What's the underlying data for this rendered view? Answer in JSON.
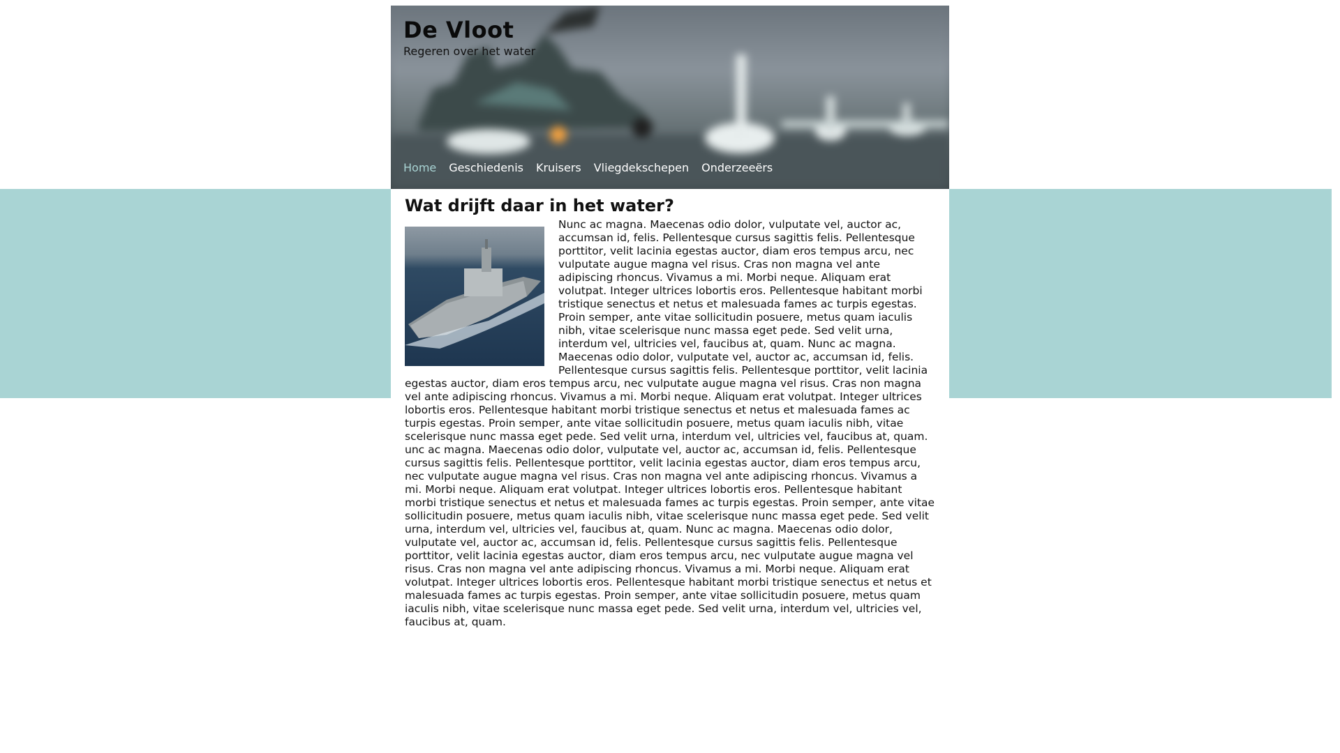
{
  "site": {
    "title": "De Vloot",
    "tagline": "Regeren over het water"
  },
  "nav": {
    "items": [
      {
        "label": "Home",
        "active": true
      },
      {
        "label": "Geschiedenis",
        "active": false
      },
      {
        "label": "Kruisers",
        "active": false
      },
      {
        "label": "Vliegdekschepen",
        "active": false
      },
      {
        "label": "Onderzeeërs",
        "active": false
      }
    ]
  },
  "article": {
    "heading": "Wat drijft daar in het water?",
    "body": "Nunc ac magna. Maecenas odio dolor, vulputate vel, auctor ac, accumsan id, felis. Pellentesque cursus sagittis felis. Pellentesque porttitor, velit lacinia egestas auctor, diam eros tempus arcu, nec vulputate augue magna vel risus. Cras non magna vel ante adipiscing rhoncus. Vivamus a mi. Morbi neque. Aliquam erat volutpat. Integer ultrices lobortis eros. Pellentesque habitant morbi tristique senectus et netus et malesuada fames ac turpis egestas. Proin semper, ante vitae sollicitudin posuere, metus quam iaculis nibh, vitae scelerisque nunc massa eget pede. Sed velit urna, interdum vel, ultricies vel, faucibus at, quam. Nunc ac magna. Maecenas odio dolor, vulputate vel, auctor ac, accumsan id, felis. Pellentesque cursus sagittis felis. Pellentesque porttitor, velit lacinia egestas auctor, diam eros tempus arcu, nec vulputate augue magna vel risus. Cras non magna vel ante adipiscing rhoncus. Vivamus a mi. Morbi neque. Aliquam erat volutpat. Integer ultrices lobortis eros. Pellentesque habitant morbi tristique senectus et netus et malesuada fames ac turpis egestas. Proin semper, ante vitae sollicitudin posuere, metus quam iaculis nibh, vitae scelerisque nunc massa eget pede. Sed velit urna, interdum vel, ultricies vel, faucibus at, quam. unc ac magna. Maecenas odio dolor, vulputate vel, auctor ac, accumsan id, felis. Pellentesque cursus sagittis felis. Pellentesque porttitor, velit lacinia egestas auctor, diam eros tempus arcu, nec vulputate augue magna vel risus. Cras non magna vel ante adipiscing rhoncus. Vivamus a mi. Morbi neque. Aliquam erat volutpat. Integer ultrices lobortis eros. Pellentesque habitant morbi tristique senectus et netus et malesuada fames ac turpis egestas. Proin semper, ante vitae sollicitudin posuere, metus quam iaculis nibh, vitae scelerisque nunc massa eget pede. Sed velit urna, interdum vel, ultricies vel, faucibus at, quam. Nunc ac magna. Maecenas odio dolor, vulputate vel, auctor ac, accumsan id, felis. Pellentesque cursus sagittis felis. Pellentesque porttitor, velit lacinia egestas auctor, diam eros tempus arcu, nec vulputate augue magna vel risus. Cras non magna vel ante adipiscing rhoncus. Vivamus a mi. Morbi neque. Aliquam erat volutpat. Integer ultrices lobortis eros. Pellentesque habitant morbi tristique senectus et netus et malesuada fames ac turpis egestas. Proin semper, ante vitae sollicitudin posuere, metus quam iaculis nibh, vitae scelerisque nunc massa eget pede. Sed velit urna, interdum vel, ultricies vel, faucibus at, quam."
  },
  "colors": {
    "band": "#a9d4d4",
    "nav_active": "#a9d4d4",
    "nav_text": "#ffffff",
    "text": "#111111"
  }
}
